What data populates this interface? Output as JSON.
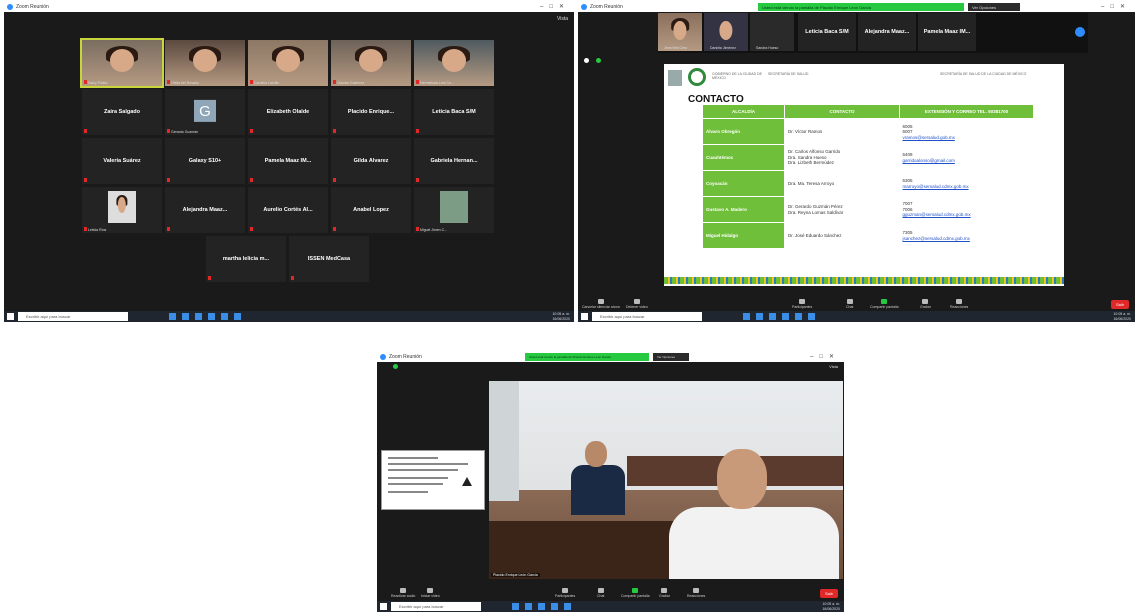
{
  "common": {
    "window_title": "Zoom Reunión",
    "view_label": "Vista",
    "search_placeholder": "Escribir aquí para buscar",
    "clock_time": "10:05 a. m.",
    "clock_date": "16/06/2020",
    "lang": "ESP",
    "share_banner": "Usted está viendo la pantalla de Placido Enrique Leon Garcia",
    "share_options": "Ver Opciones",
    "end_label": "Salir",
    "accent": "#2d8cff",
    "share_green": "#26c940",
    "end_red": "#e02828"
  },
  "grid": {
    "video_tiles": [
      {
        "caption": "Daicy Pulido"
      },
      {
        "caption": "Ofelia del Rosario"
      },
      {
        "caption": "Carolina Carrillo"
      },
      {
        "caption": "Claudia Gutiérrez"
      },
      {
        "caption": "Hermelinda Leal Ce..."
      }
    ],
    "name_tiles": [
      "Zaira Salgado",
      "G",
      "Elizabeth Olalde",
      "Placido Enrique...",
      "Leticia Baca S/M",
      "Valeria Suárez",
      "Galaxy S10+",
      "Pamela Maaz IM...",
      "Gilda Álvarez",
      "Gabriela Hernan...",
      "",
      "Alejandra Maaz...",
      "Aurelio Cortés Al...",
      "Anabel Lopez",
      "",
      "martha lelicia m...",
      "ISSEN MedCasa"
    ],
    "g_caption": "Gerardo Guzmán",
    "photo_tile_caption": "Leticia Ríos",
    "last_video_caption": "Miguel Jimen C..."
  },
  "share_view": {
    "thumbs": [
      {
        "caption": "Leticia Baca S/M",
        "type": "name"
      },
      {
        "caption": "Alejandra Maaz...",
        "type": "name"
      },
      {
        "caption": "Pamela Maaz IM...",
        "type": "name"
      }
    ],
    "video_thumbs": [
      {
        "caption": "Jenn Wei Cero"
      },
      {
        "caption": "Daniela Jiménez"
      },
      {
        "caption": "Sandra Hueso"
      }
    ],
    "doc": {
      "header_left": "GOBIERNO DE LA CIUDAD DE MÉXICO",
      "header_mid": "SECRETARÍA DE SALUD",
      "header_right": "SECRETARÍA DE SALUD DE LA CIUDAD DE MÉXICO",
      "title": "CONTACTO",
      "columns": [
        "ALCALDÍA",
        "CONTACTO",
        "EXTENSIÓN Y CORREO TEL. 50381700"
      ],
      "rows": [
        {
          "alcaldia": "Álvaro Obregón",
          "contacto": [
            "Dr. Víctor Ramos"
          ],
          "ext": [
            "6005",
            "6007"
          ],
          "mail": "vramos@sersalud.gob.mx"
        },
        {
          "alcaldia": "Cuauhtémoc",
          "contacto": [
            "Dr. Carlos Alfonso Garrido",
            "Dra. Sandra Hueso",
            "Dra. Lizbeth Bermúdez"
          ],
          "ext": [
            "6408"
          ],
          "mail": "garridoalonso@gmail.com"
        },
        {
          "alcaldia": "Coyoacán",
          "contacto": [
            "Dra. Ma. Teresa Arroyo"
          ],
          "ext": [
            "6305"
          ],
          "mail": "marroyo@sersalud.cdmx.gob.mx"
        },
        {
          "alcaldia": "Gustavo A. Madero",
          "contacto": [
            "Dr. Gerardo Guzmán Pérez",
            "Dra. Reyna Lomas Saldívar"
          ],
          "ext": [
            "7007",
            "7006"
          ],
          "mail": "gguzman@sersalud.cdmx.gob.mx"
        },
        {
          "alcaldia": "Miguel Hidalgo",
          "contacto": [
            "Dr. José Eduardo Sánchez"
          ],
          "ext": [
            "7305"
          ],
          "mail": "jsanchez@sersalud.cdmx.gob.mx"
        }
      ]
    },
    "controls": [
      "Cancelar silenciar ahora",
      "Detener video",
      "Participantes",
      "Chat",
      "Compartir pantalla",
      "Grabar",
      "Reacciones"
    ]
  },
  "speaker_view": {
    "video_name": "Placido Enrique León García",
    "controls": [
      "Reactivar audio",
      "Iniciar video",
      "Participantes",
      "Chat",
      "Compartir pantalla",
      "Grabar",
      "Reacciones"
    ]
  }
}
